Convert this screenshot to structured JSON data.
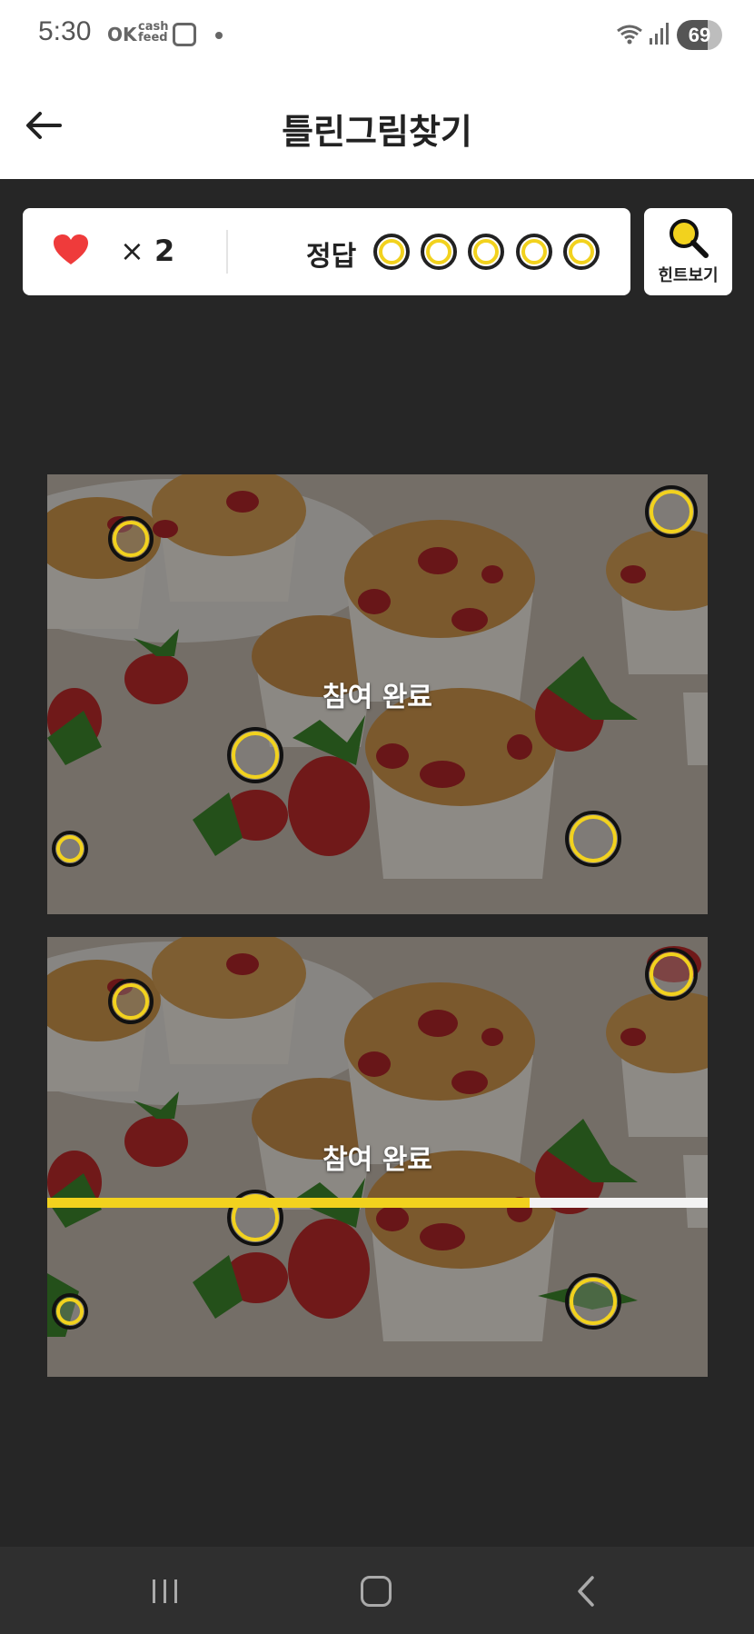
{
  "status_bar": {
    "time": "5:30",
    "ok": "OK",
    "cash_feed": "cash feed",
    "battery": "69"
  },
  "header": {
    "title": "틀린그림찾기"
  },
  "score": {
    "lives_symbol": "×",
    "lives": "2",
    "answer_label": "정답",
    "answer_slots": 5,
    "answers_found": 0
  },
  "hint": {
    "label": "힌트보기"
  },
  "puzzle": {
    "completed_label": "참여 완료",
    "top_label": "참여 완료",
    "bottom_label": "참여 완료"
  },
  "timer": {
    "progress": 0.73
  },
  "colors": {
    "accent": "#f2d21e",
    "heart": "#ef3b3b",
    "background": "#262626"
  },
  "icons": [
    "back-arrow-icon",
    "heart-icon",
    "magnifier-icon",
    "recent-apps-icon",
    "home-icon",
    "nav-back-icon"
  ]
}
